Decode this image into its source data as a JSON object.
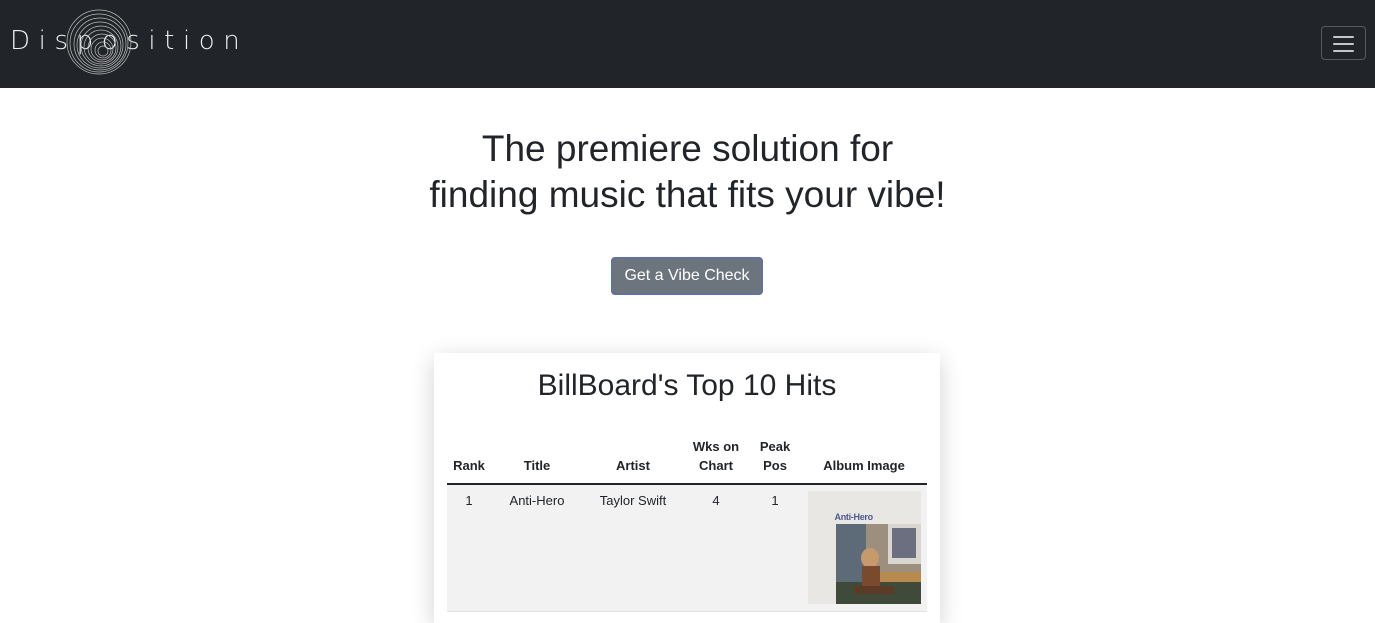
{
  "navbar": {
    "brand": "Disposition",
    "logo_icon": "vinyl-rings-icon",
    "menu_icon": "hamburger-menu-icon",
    "background": "#212529"
  },
  "hero": {
    "line1": "The premiere solution for",
    "line2": "finding music that fits your vibe!"
  },
  "cta": {
    "label": "Get a Vibe Check",
    "background": "#6c757d"
  },
  "chart_table": {
    "title": "BillBoard's Top 10 Hits",
    "columns": [
      "Rank",
      "Title",
      "Artist",
      "Wks on Chart",
      "Peak Pos",
      "Album Image"
    ],
    "rows": [
      {
        "rank": "1",
        "title": "Anti-Hero",
        "artist": "Taylor Swift",
        "weeks": "4",
        "peak": "1",
        "album_text": "Anti-Hero"
      }
    ]
  }
}
